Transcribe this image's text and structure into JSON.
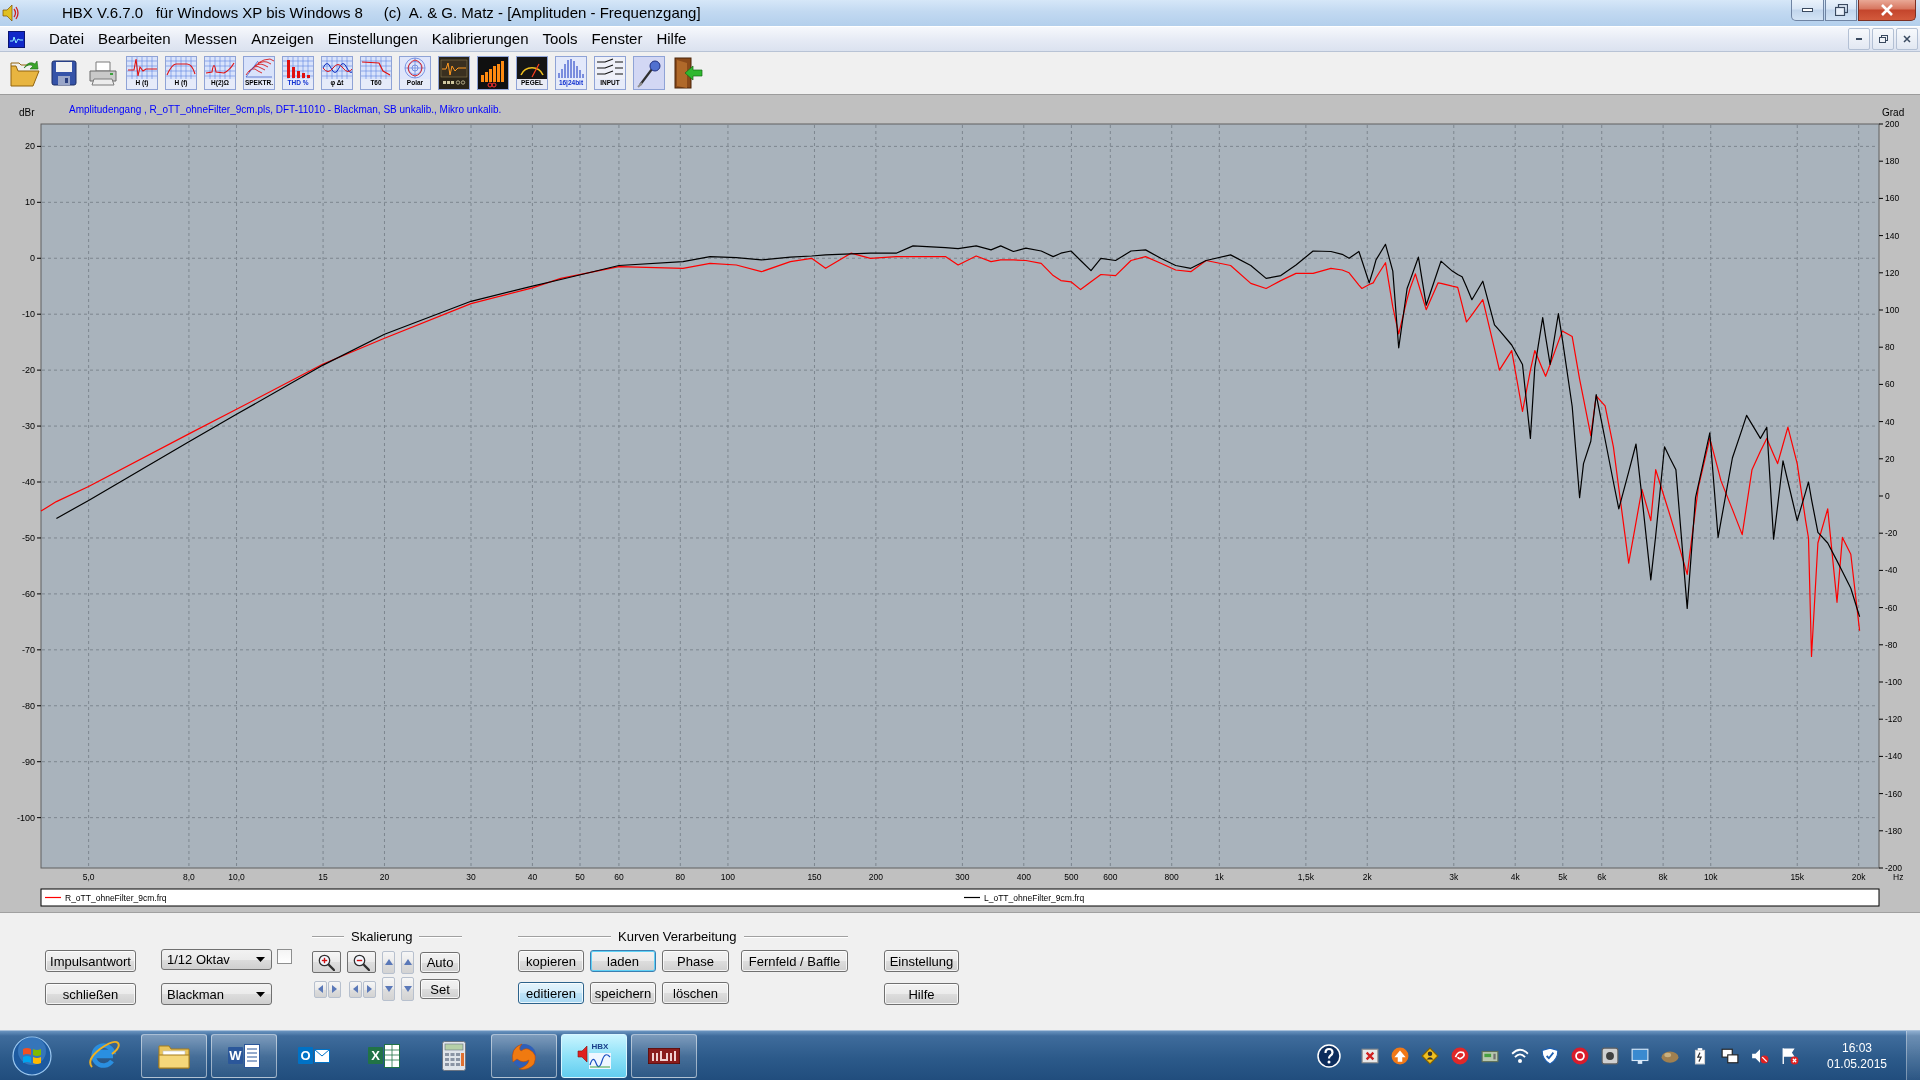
{
  "window": {
    "title": "HBX V.6.7.0   für Windows XP bis Windows 8     (c)  A. & G. Matz - [Amplituden - Frequenzgang]"
  },
  "menu": [
    "Datei",
    "Bearbeiten",
    "Messen",
    "Anzeigen",
    "Einstellungen",
    "Kalibrierungen",
    "Tools",
    "Fenster",
    "Hilfe"
  ],
  "toolbar": [
    {
      "kind": "open"
    },
    {
      "kind": "save"
    },
    {
      "kind": "print"
    },
    {
      "kind": "impulse",
      "label": "H (t)"
    },
    {
      "kind": "frequency",
      "label": "H (f)"
    },
    {
      "kind": "impedance",
      "label": "H(2)Ω"
    },
    {
      "kind": "spectrum",
      "label": "SPEKTR."
    },
    {
      "kind": "distortion",
      "label": "THD %"
    },
    {
      "kind": "phase",
      "label": "φ Δt"
    },
    {
      "kind": "decay",
      "label": "T60"
    },
    {
      "kind": "polar",
      "label": "Polar"
    },
    {
      "kind": "scope"
    },
    {
      "kind": "bars"
    },
    {
      "kind": "level",
      "label": "PEGEL"
    },
    {
      "kind": "bits",
      "label": "16|24bit"
    },
    {
      "kind": "input",
      "label": "INPUT"
    },
    {
      "kind": "mic"
    },
    {
      "kind": "exit"
    }
  ],
  "chart": {
    "chart_data": {
      "type": "line",
      "title": "Amplitudengang , R_oTT_ohneFilter_9cm.pls, DFT-11010 - Blackman, SB unkalib., Mikro unkalib.",
      "xlabel": "Hz",
      "ylabel": "dBr",
      "log": "x",
      "grid": true,
      "legend": "bottom",
      "x": [
        4,
        4.3,
        5,
        8,
        10,
        15,
        20,
        30,
        40,
        45.7,
        60,
        81,
        92,
        104,
        117,
        134,
        148,
        158,
        178,
        195,
        220,
        238,
        277,
        294,
        320,
        343,
        359,
        381,
        404,
        434,
        459,
        476,
        499,
        522,
        548,
        574,
        615,
        661,
        708,
        760,
        815,
        875,
        940,
        1054,
        1159,
        1245,
        1334,
        1432,
        1552,
        1687,
        1778,
        1837,
        1923,
        1950,
        2018,
        2056,
        2084,
        2178,
        2254,
        2317,
        2410,
        2443,
        2506,
        2541,
        2636,
        2786,
        2825,
        2979,
        3055,
        3119,
        3184,
        3266,
        3436,
        3631,
        3715,
        3936,
        4140,
        4295,
        4385,
        4550,
        4613,
        4710,
        4898,
        4989,
        5224,
        5408,
        5508,
        5702,
        5848,
        6012,
        6095,
        6339,
        6501,
        6808,
        7047,
        7244,
        7551,
        7727,
        8054,
        8260,
        8492,
        8954,
        9311,
        9441,
        9954,
        10351,
        10495,
        11066,
        11588,
        11830,
        12134,
        12618,
        13002,
        13428,
        13677,
        14028,
        14355,
        14997,
        15596,
        15812,
        16032,
        16520,
        17298,
        18072,
        18535,
        19275,
        20091
      ],
      "series": [
        {
          "name": "R_oTT_ohneFilter_9cm.frq",
          "color": "#ff0000",
          "values": [
            -45.2,
            -43.5,
            -40.8,
            -31.4,
            -27.0,
            -18.9,
            -14.3,
            -8.1,
            -5.3,
            -3.6,
            -1.5,
            -1.8,
            -0.9,
            -1.2,
            -2.4,
            -0.6,
            0,
            -1.8,
            0.9,
            0,
            0.3,
            0.3,
            0.3,
            -1.2,
            0.4,
            -0.6,
            -0.3,
            -0.3,
            -0.4,
            -0.9,
            -3.1,
            -4.0,
            -4.2,
            -5.6,
            -4.2,
            -2.9,
            -3.1,
            -0.4,
            0.3,
            -0.9,
            -2.1,
            -2.4,
            -0.4,
            -1.3,
            -4.5,
            -5.4,
            -4.0,
            -2.7,
            -2.7,
            -1.8,
            -2.1,
            -2.6,
            -4.8,
            -5.4,
            -4.7,
            -4.4,
            -3.5,
            -0.8,
            -8.7,
            -13.5,
            -7.3,
            -5.4,
            -2.8,
            -4.6,
            -9.2,
            -4.4,
            -4.5,
            -5.0,
            -5.2,
            -8.3,
            -11.4,
            -10.1,
            -7.4,
            -16.2,
            -20.0,
            -16.5,
            -27.4,
            -20.0,
            -16.5,
            -19.9,
            -21.1,
            -19.0,
            -14.9,
            -13.0,
            -14.0,
            -21.6,
            -25.1,
            -31.7,
            -24.6,
            -25.8,
            -26.4,
            -33.7,
            -41.1,
            -54.5,
            -47.2,
            -41.3,
            -46.9,
            -37.8,
            -42.8,
            -45.9,
            -49.5,
            -56.5,
            -44.9,
            -40.8,
            -32.2,
            -37.8,
            -39.8,
            -44.9,
            -49.4,
            -44.2,
            -37.8,
            -34.5,
            -32.2,
            -35.1,
            -36.7,
            -33.3,
            -30.2,
            -36.7,
            -46.9,
            -50.0,
            -71.2,
            -50.9,
            -44.8,
            -61.5,
            -49.9,
            -52.9,
            -66.6
          ]
        },
        {
          "name": "L_oTT_ohneFilter_9cm.frq",
          "color": "#000000",
          "values": [
            null,
            -46.5,
            -43.3,
            -32.8,
            -27.9,
            -19.1,
            -13.6,
            -7.7,
            -5.0,
            -3.8,
            -1.3,
            -0.6,
            0.3,
            0.1,
            -0.3,
            0.2,
            0.4,
            0.6,
            0.8,
            0.9,
            0.9,
            2.2,
            1.9,
            1.7,
            2.2,
            1.5,
            2.2,
            1.2,
            1.8,
            1.3,
            0.3,
            0.9,
            1.3,
            -0.4,
            -2.2,
            0,
            -0.4,
            1.3,
            1.5,
            0,
            -1.3,
            -1.8,
            -0.4,
            0.6,
            -1.3,
            -3.6,
            -3.1,
            -1.2,
            1.3,
            1.2,
            0.7,
            0.0,
            1.2,
            -0.4,
            -4.4,
            -2.1,
            -0.3,
            2.5,
            -2.3,
            -16.0,
            -5.4,
            -4.0,
            -1.3,
            0.2,
            -8.4,
            -2.1,
            -0.5,
            -2.3,
            -2.9,
            -3.3,
            -5.1,
            -7.4,
            -4.1,
            -11.9,
            -12.9,
            -15.5,
            -19.0,
            -32.2,
            -19.5,
            -10.6,
            -14.0,
            -19.0,
            -9.9,
            -14.4,
            -26.5,
            -42.8,
            -36.7,
            -32.7,
            -24.4,
            -29.7,
            -32.4,
            -40.0,
            -44.8,
            -38.2,
            -33.2,
            -42.6,
            -57.5,
            -49.6,
            -33.7,
            -35.7,
            -37.8,
            -62.6,
            -42.8,
            -40.4,
            -31.2,
            -49.9,
            -47.0,
            -35.7,
            -30.5,
            -28.1,
            -29.7,
            -32.2,
            -30.2,
            -50.2,
            -44.3,
            -36.2,
            -39.9,
            -46.9,
            -41.8,
            -40.0,
            -43.1,
            -49.0,
            -50.9,
            -54.1,
            -56.0,
            -59.0,
            -64.1
          ]
        }
      ],
      "xlim": [
        4,
        22000
      ],
      "ylim": [
        -109,
        24
      ],
      "xticks": [
        {
          "value": 5,
          "label": "5,0"
        },
        {
          "value": 8,
          "label": "8,0"
        },
        {
          "value": 10,
          "label": "10,0"
        },
        15,
        20,
        30,
        40,
        50,
        60,
        80,
        100,
        150,
        200,
        300,
        400,
        500,
        600,
        800,
        {
          "value": 1000,
          "label": "1k"
        },
        {
          "value": 1500,
          "label": "1,5k"
        },
        {
          "value": 2000,
          "label": "2k"
        },
        {
          "value": 3000,
          "label": "3k"
        },
        {
          "value": 4000,
          "label": "4k"
        },
        {
          "value": 5000,
          "label": "5k"
        },
        {
          "value": 6000,
          "label": "6k"
        },
        {
          "value": 8000,
          "label": "8k"
        },
        {
          "value": 10000,
          "label": "10k"
        },
        {
          "value": 15000,
          "label": "15k"
        },
        {
          "value": 20000,
          "label": "20k"
        }
      ],
      "yticks": [
        20,
        10,
        0,
        -10,
        -20,
        -30,
        -40,
        -50,
        -60,
        -70,
        -80,
        -90,
        -100
      ],
      "y2label": "Grad",
      "y2lim": [
        -200,
        200
      ],
      "y2ticks": [
        200,
        180,
        160,
        140,
        120,
        100,
        80,
        60,
        40,
        20,
        0,
        -20,
        -40,
        -60,
        -80,
        -100,
        -120,
        -140,
        -160,
        -180,
        -200
      ]
    }
  },
  "controls": {
    "left_buttons": [
      "Impulsantwort",
      "schließen"
    ],
    "dropdowns": [
      {
        "value": "1/12 Oktav"
      },
      {
        "value": "Blackman"
      }
    ],
    "checkbox": {
      "checked": false
    },
    "scaling": {
      "title": "Skalierung",
      "buttons": [
        "Auto",
        "Set"
      ]
    },
    "curves": {
      "title": "Kurven Verarbeitung",
      "rows": [
        [
          {
            "label": "kopieren",
            "focused": false,
            "pressed": false
          },
          {
            "label": "laden",
            "focused": true,
            "pressed": false
          },
          {
            "label": "Phase",
            "focused": false,
            "pressed": false
          },
          {
            "label": "Fernfeld / Baffle",
            "focused": false,
            "pressed": false
          }
        ],
        [
          {
            "label": "editieren",
            "focused": false,
            "pressed": true
          },
          {
            "label": "speichern",
            "focused": false,
            "pressed": false
          },
          {
            "label": "löschen",
            "focused": false,
            "pressed": false
          }
        ]
      ]
    },
    "right_buttons": [
      "Einstellung",
      "Hilfe"
    ]
  },
  "taskbar": {
    "apps": [
      {
        "kind": "browser",
        "running": false,
        "selected": false
      },
      {
        "kind": "folder",
        "running": true,
        "selected": false
      },
      {
        "kind": "document",
        "glyph": "W",
        "running": true,
        "selected": false
      },
      {
        "kind": "mail",
        "glyph": "O",
        "running": false,
        "selected": false
      },
      {
        "kind": "sheet",
        "glyph": "X",
        "running": false,
        "selected": false
      },
      {
        "kind": "calculator",
        "running": false,
        "selected": false
      },
      {
        "kind": "globe",
        "running": true,
        "selected": false
      },
      {
        "kind": "analyzer",
        "glyph": "HBX",
        "running": true,
        "selected": true
      },
      {
        "kind": "meter",
        "running": true,
        "selected": false
      }
    ],
    "clock": {
      "time": "16:03",
      "date": "01.05.2015"
    }
  }
}
